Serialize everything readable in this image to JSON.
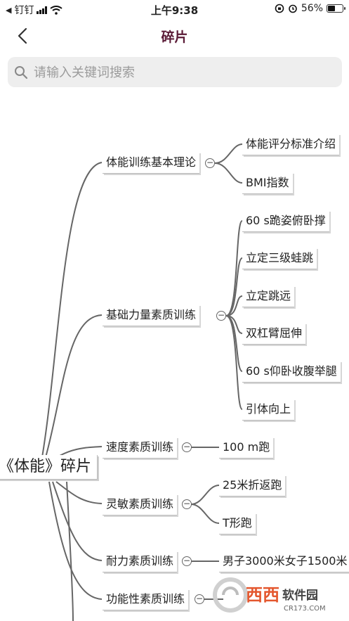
{
  "status_bar": {
    "carrier": "钉钉",
    "time": "上午9:38",
    "battery": "56%",
    "battery_level": 0.56
  },
  "nav": {
    "title": "碎片"
  },
  "search": {
    "placeholder": "请输入关键词搜索",
    "value": ""
  },
  "mindmap": {
    "root": "《体能》碎片",
    "branches": [
      {
        "label": "体能训练基本理论",
        "children": [
          "体能评分标准介绍",
          "BMI指数"
        ]
      },
      {
        "label": "基础力量素质训练",
        "children": [
          "60 s跪姿俯卧撑",
          "立定三级蛙跳",
          "立定跳远",
          "双杠臂屈伸",
          "60 s仰卧收腹举腿",
          "引体向上"
        ]
      },
      {
        "label": "速度素质训练",
        "children": [
          "100 m跑"
        ]
      },
      {
        "label": "灵敏素质训练",
        "children": [
          "25米折返跑",
          "T形跑"
        ]
      },
      {
        "label": "耐力素质训练",
        "children": [
          "男子3000米女子1500米"
        ]
      },
      {
        "label": "功能性素质训练",
        "children": []
      }
    ]
  },
  "watermark": {
    "text": "西西软件园",
    "domain": "CR173.COM",
    "accent": "#e4572e"
  },
  "colors": {
    "title": "#5a1a36",
    "line": "#666666",
    "search_bg": "#eeeeee"
  }
}
